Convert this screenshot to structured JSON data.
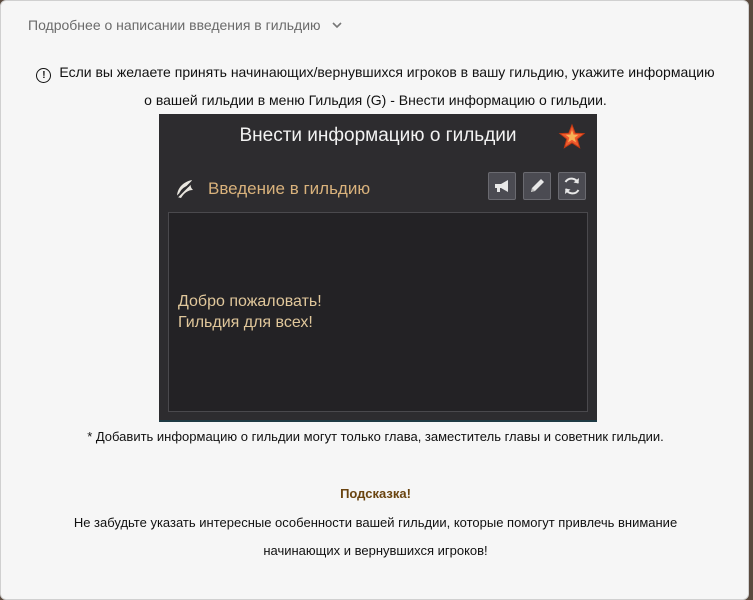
{
  "accordion": {
    "title": "Подробнее о написании введения в гильдию",
    "chevron_icon": "chevron-down-icon"
  },
  "info": {
    "icon": "info-circle-icon",
    "icon_glyph": "!",
    "line1": "Если вы желаете принять начинающих/вернувшихся игроков в вашу гильдию, укажите информацию",
    "line2": "о вашей гильдии в меню Гильдия (G) - Внести информацию о гильдии."
  },
  "game_window": {
    "title": "Внести информацию о гильдии",
    "star_icon": "starfish-icon",
    "guild_logo_icon": "guild-emblem-icon",
    "section_label": "Введение в гильдию",
    "buttons": [
      {
        "name": "announce-button",
        "icon": "megaphone-icon"
      },
      {
        "name": "edit-button",
        "icon": "pencil-icon"
      },
      {
        "name": "refresh-button",
        "icon": "refresh-icon"
      }
    ],
    "intro_text": "Добро пожаловать!\nГильдия для всех!"
  },
  "note": "* Добавить информацию о гильдии могут только глава, заместитель главы и советник гильдии.",
  "tip": {
    "title": "Подсказка!",
    "line1": "Не забудьте указать интересные особенности вашей гильдии, которые помогут привлечь внимание",
    "line2": "начинающих и вернувшихся игроков!"
  },
  "colors": {
    "panel_bg": "#f6f6f6",
    "game_bg": "#2d2c2f",
    "guild_label": "#d9b27c",
    "intro_text": "#e0c79b",
    "tip_title": "#6a4410"
  }
}
